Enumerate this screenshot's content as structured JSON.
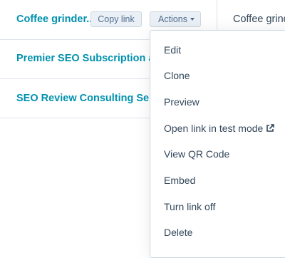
{
  "table": {
    "rows": [
      {
        "name": "Coffee grinder...",
        "next": "Coffee grindi"
      },
      {
        "name": "Premier SEO Subscription an",
        "next": ""
      },
      {
        "name": "SEO Review Consulting Servi",
        "next": ""
      }
    ],
    "copy_link_label": "Copy link",
    "actions_label": "Actions"
  },
  "menu": {
    "items": [
      {
        "label": "Edit"
      },
      {
        "label": "Clone"
      },
      {
        "label": "Preview"
      },
      {
        "label": "Open link in test mode",
        "icon": "external-link-icon"
      },
      {
        "label": "View QR Code"
      },
      {
        "label": "Embed"
      },
      {
        "label": "Turn link off"
      },
      {
        "label": "Delete"
      }
    ]
  },
  "colors": {
    "link": "#0091ae",
    "text": "#33475b",
    "button_bg": "#eaf0f6",
    "border": "#dfe3eb"
  }
}
